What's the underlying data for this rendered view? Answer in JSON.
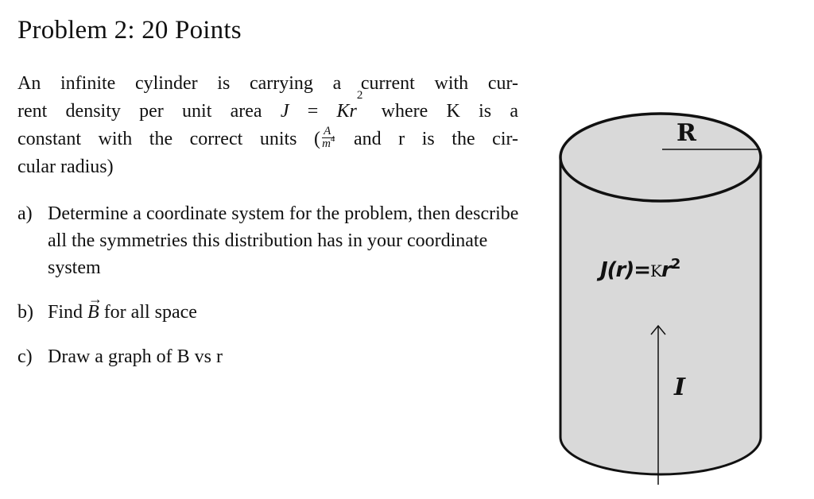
{
  "title": "Problem 2: 20 Points",
  "intro": {
    "line1": "An infinite cylinder is carrying a current with cur-",
    "line2_a": "rent density per unit area ",
    "line2_eq_lhs": "J",
    "line2_eq_sign": " = ",
    "line2_eq_rhs": "Kr",
    "line2_exp": "2",
    "line2_b": " where K is a",
    "line3_a": "constant with the correct units (",
    "units_num": "A",
    "units_den": "m",
    "units_den_exp": "4",
    "line3_b": " and r is the cir-",
    "line4": "cular radius)"
  },
  "parts": [
    {
      "marker": "a)",
      "text": "Determine a coordinate system for the problem, then describe all the symmetries this distribution has in your coordinate system"
    },
    {
      "marker": "b)",
      "text_a": "Find ",
      "vector": "B",
      "text_b": " for all space"
    },
    {
      "marker": "c)",
      "text": "Draw a graph of B vs r"
    }
  ],
  "figure": {
    "radius_label": "R",
    "density_label_prefix": "J(r)=",
    "density_label_K": "K",
    "density_label_r": "r",
    "density_label_exp": "2",
    "current_label": "I",
    "fill_color": "#d9d9d9",
    "stroke_color": "#111111"
  }
}
